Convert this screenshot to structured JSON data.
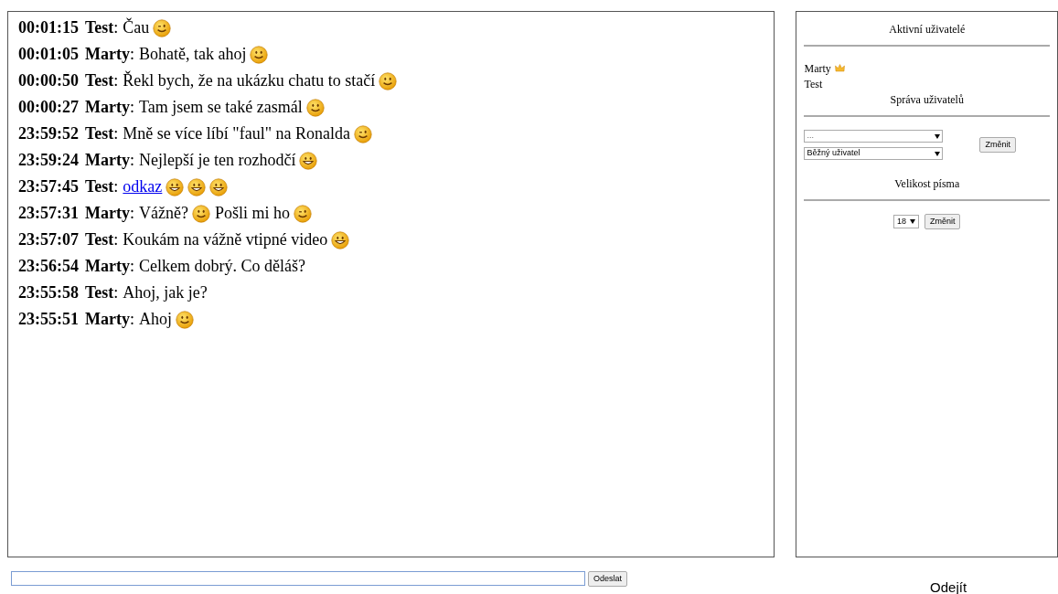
{
  "messages": [
    {
      "time": "00:01:15",
      "user": "Test",
      "separator": ":",
      "parts": [
        {
          "kind": "text",
          "text": "Čau"
        },
        {
          "kind": "wink"
        }
      ]
    },
    {
      "time": "00:01:05",
      "user": "Marty",
      "separator": ":",
      "parts": [
        {
          "kind": "text",
          "text": "Bohatě, tak ahoj"
        },
        {
          "kind": "smile"
        }
      ]
    },
    {
      "time": "00:00:50",
      "user": "Test",
      "separator": ":",
      "parts": [
        {
          "kind": "text",
          "text": "Řekl bych, že na ukázku chatu to stačí"
        },
        {
          "kind": "smile"
        }
      ]
    },
    {
      "time": "00:00:27",
      "user": "Marty",
      "separator": ":",
      "parts": [
        {
          "kind": "text",
          "text": "Tam jsem se také zasmál"
        },
        {
          "kind": "smile"
        }
      ]
    },
    {
      "time": "23:59:52",
      "user": "Test",
      "separator": ":",
      "parts": [
        {
          "kind": "text",
          "text": "Mně se více líbí \"faul\" na Ronalda"
        },
        {
          "kind": "wink"
        }
      ]
    },
    {
      "time": "23:59:24",
      "user": "Marty",
      "separator": ":",
      "parts": [
        {
          "kind": "text",
          "text": "Nejlepší je ten rozhodčí"
        },
        {
          "kind": "grin"
        }
      ]
    },
    {
      "time": "23:57:45",
      "user": "Test",
      "separator": ":",
      "parts": [
        {
          "kind": "link",
          "text": "odkaz"
        },
        {
          "kind": "grin"
        },
        {
          "kind": "grin"
        },
        {
          "kind": "grin"
        }
      ]
    },
    {
      "time": "23:57:31",
      "user": "Marty",
      "separator": ":",
      "parts": [
        {
          "kind": "text",
          "text": "Vážně?"
        },
        {
          "kind": "smile"
        },
        {
          "kind": "text",
          "text": "Pošli mi ho"
        },
        {
          "kind": "wink"
        }
      ]
    },
    {
      "time": "23:57:07",
      "user": "Test",
      "separator": ":",
      "parts": [
        {
          "kind": "text",
          "text": "Koukám na vážně vtipné video"
        },
        {
          "kind": "grin"
        }
      ]
    },
    {
      "time": "23:56:54",
      "user": "Marty",
      "separator": ":",
      "parts": [
        {
          "kind": "text",
          "text": "Celkem dobrý. Co děláš?"
        }
      ]
    },
    {
      "time": "23:55:58",
      "user": "Test",
      "separator": ":",
      "parts": [
        {
          "kind": "text",
          "text": "Ahoj, jak je?"
        }
      ]
    },
    {
      "time": "23:55:51",
      "user": "Marty",
      "separator": ":",
      "parts": [
        {
          "kind": "text",
          "text": "Ahoj"
        },
        {
          "kind": "smile"
        }
      ]
    }
  ],
  "sidebar": {
    "active_title": "Aktivní uživatelé",
    "users": [
      {
        "name": "Marty",
        "admin": true
      },
      {
        "name": "Test",
        "admin": false
      }
    ],
    "manage_title": "Správa uživatelů",
    "user_select": "...",
    "role_select": "Běžný uživatel",
    "manage_button": "Změnit",
    "font_title": "Velikost písma",
    "font_select": "18",
    "font_button": "Změnit"
  },
  "composer": {
    "send_button": "Odeslat"
  },
  "leave_link": "Odejít"
}
